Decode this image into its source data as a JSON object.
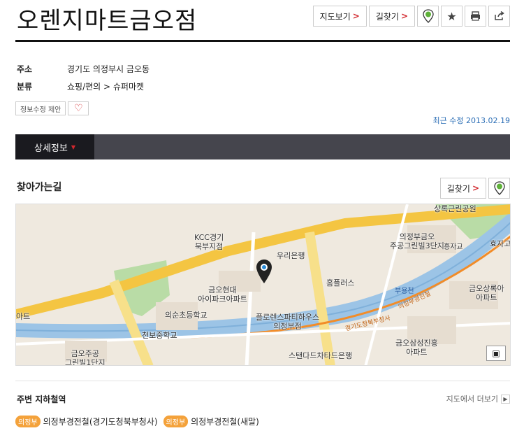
{
  "place": {
    "name": "오렌지마트금오점"
  },
  "top_buttons": {
    "map_view": "지도보기",
    "directions": "길찾기",
    "arrow": ">"
  },
  "info": {
    "address_label": "주소",
    "address": "경기도 의정부시 금오동",
    "category_label": "분류",
    "category": "쇼핑/편의 > 슈퍼마켓"
  },
  "actions": {
    "suggest_edit": "정보수정 제안",
    "heart": "♡"
  },
  "updated": "최근 수정 2013.02.19",
  "tabs": {
    "active": "상세정보"
  },
  "directions_section": {
    "title": "찾아가는길",
    "button": "길찾기"
  },
  "map": {
    "labels": [
      "KCC경기\n북부지점",
      "우리은행",
      "홈플러스",
      "금오현대\n아이파크아파트",
      "의순초등학교",
      "천보중학교",
      "플로렌스파티하우스\n의정부점",
      "금오주공\n그린빌1단지",
      "스탠다드차타드은행",
      "의정부금오\n주공그린빌3단지",
      "금오상록아\n아파트",
      "금오삼성진흥\n아파트",
      "효자고",
      "아트",
      "상록근린공원",
      "부용천",
      "흥자교",
      "경기도청북부청사",
      "의정부경전철"
    ]
  },
  "nearby": {
    "title": "주변 지하철역",
    "more": "지도에서 더보기",
    "stations": [
      {
        "line": "의정부",
        "name": "의정부경전철(경기도청북부청사)"
      },
      {
        "line": "의정부",
        "name": "의정부경전철(새말)"
      }
    ]
  },
  "colors": {
    "accent_red": "#d2282e",
    "link_blue": "#2a6db5",
    "badge_orange": "#f4a23b",
    "tab_dark": "#45454d"
  }
}
